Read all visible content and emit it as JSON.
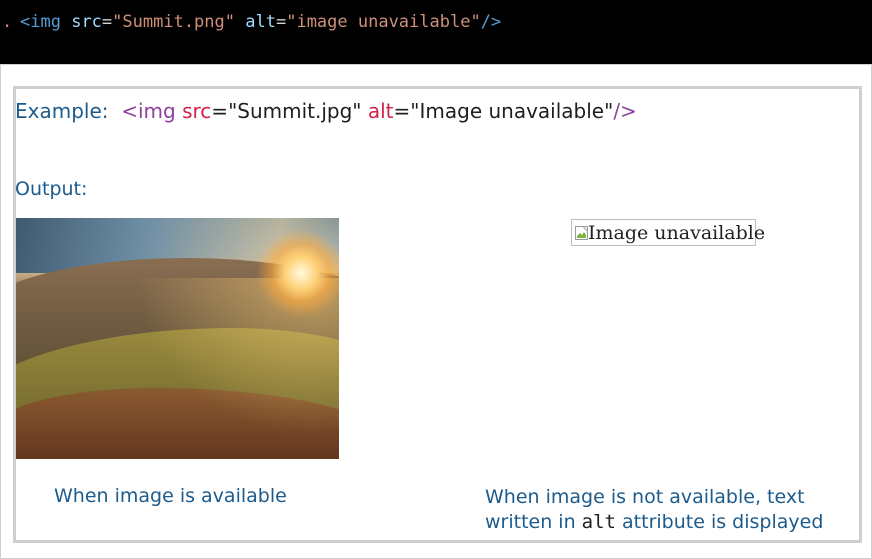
{
  "code_strip": {
    "dot": ".",
    "tag_open": "<img",
    "attr_src": "src",
    "src_value": "\"Summit.png\"",
    "attr_alt": "alt",
    "alt_value": "\"image unavailable\"",
    "tag_close": "/>"
  },
  "example": {
    "label": "Example:",
    "tag_open": "<img",
    "attr_src": "src",
    "eq1": "=",
    "src_value": "\"Summit.jpg\"",
    "attr_alt": "alt",
    "eq2": "=",
    "alt_value": "\"Image unavailable\"",
    "tag_close": "/>"
  },
  "output_label": "Output:",
  "broken_image": {
    "alt_text": "Image unavailable"
  },
  "captions": {
    "left": "When image is available",
    "right_line1": "When image is not available, text",
    "right_line2_prefix": "written in ",
    "right_line2_code": "alt",
    "right_line2_suffix": " attribute is displayed"
  },
  "colors": {
    "label_blue": "#1c5b8c",
    "tag_purple": "#8e3fa0",
    "attr_red": "#d4214a"
  }
}
